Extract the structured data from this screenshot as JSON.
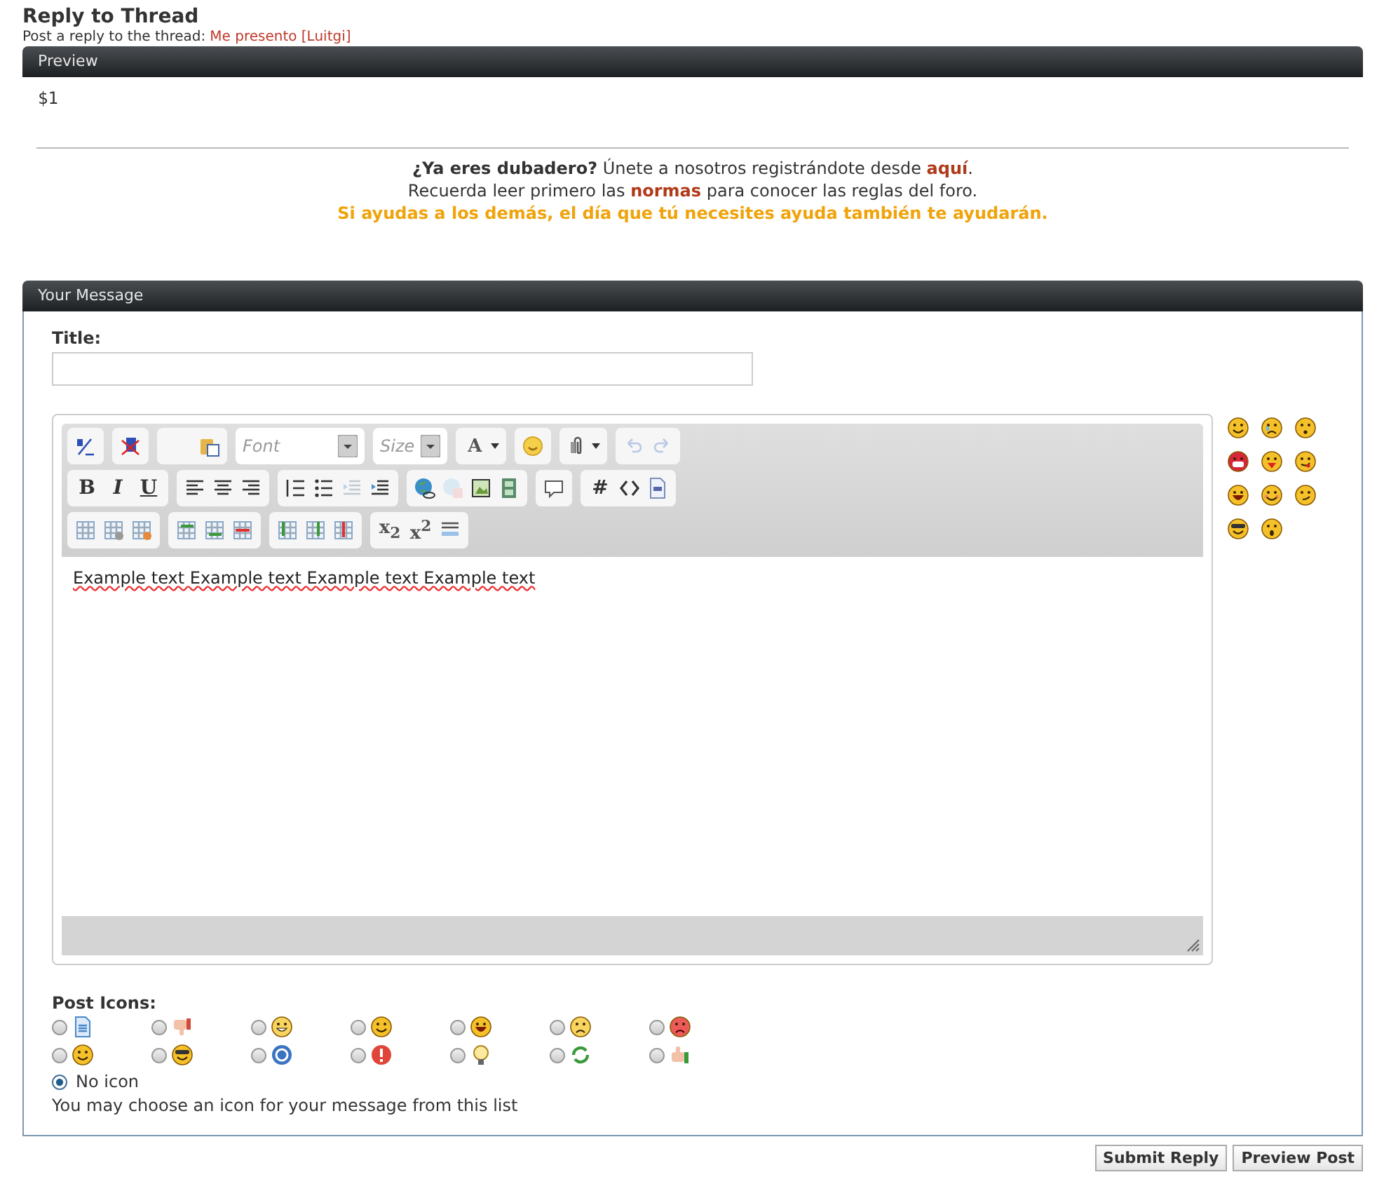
{
  "header": {
    "title": "Reply to Thread",
    "subtitle": "Post a reply to the thread:",
    "thread_link": "Me presento [Luitgi]"
  },
  "preview": {
    "title": "Preview",
    "content": "$1"
  },
  "notice": {
    "line1": {
      "before": "**¿Ya eres dubadero?** Únete a nosotros registrándote desde ",
      "link": "aquí",
      "after": "."
    },
    "line2": {
      "before": "Recuerda leer primero las ",
      "link": "normas",
      "after": " para conocer las reglas del foro."
    },
    "line3": "Si ayudas a los demás, el día que tú necesites ayuda también te ayudarán."
  },
  "message": {
    "title": "Your Message",
    "title_label": "Title:",
    "toolbar": [
      [
        [
          {
            "kind": "format"
          }
        ],
        [
          {
            "kind": "unformat"
          }
        ],
        [
          {
            "kind": "paste"
          }
        ],
        [
          {
            "kind": "select",
            "placeholder": "Font"
          }
        ],
        [
          {
            "kind": "select",
            "placeholder": "Size"
          }
        ],
        [
          {
            "kind": "color",
            "label": "A"
          }
        ],
        [
          {
            "kind": "smiley"
          }
        ],
        [
          {
            "kind": "clip"
          }
        ],
        [
          {
            "kind": "undo",
            "disabled": true
          },
          {
            "kind": "redo",
            "disabled": true
          }
        ]
      ],
      [
        [
          {
            "kind": "bold",
            "label": "B"
          },
          {
            "kind": "italic",
            "label": "I"
          },
          {
            "kind": "underline",
            "label": "U"
          }
        ],
        [
          {
            "kind": "align-left"
          },
          {
            "kind": "align-center"
          },
          {
            "kind": "align-right"
          }
        ],
        [
          {
            "kind": "ol",
            "disabled": false
          },
          {
            "kind": "ul",
            "disabled": false
          },
          {
            "kind": "outdent",
            "disabled": true
          },
          {
            "kind": "indent",
            "disabled": false
          }
        ],
        [
          {
            "kind": "globe",
            "disabled": false
          },
          {
            "kind": "unlink",
            "disabled": true
          },
          {
            "kind": "image",
            "disabled": false
          },
          {
            "kind": "film",
            "disabled": false
          }
        ],
        [
          {
            "kind": "bubble"
          }
        ],
        [
          {
            "kind": "hash",
            "label": "#"
          },
          {
            "kind": "code"
          },
          {
            "kind": "php"
          }
        ]
      ],
      [
        [
          {
            "kind": "table"
          },
          {
            "kind": "table-gear"
          },
          {
            "kind": "table-del"
          }
        ],
        [
          {
            "kind": "col-left"
          },
          {
            "kind": "col-left2"
          },
          {
            "kind": "col-right"
          }
        ],
        [
          {
            "kind": "row-down"
          },
          {
            "kind": "row-down2"
          },
          {
            "kind": "row-del"
          }
        ],
        [
          {
            "kind": "script",
            "label": "x$_{2}$"
          },
          {
            "kind": "script",
            "label": "x$^{2}$"
          },
          {
            "kind": "hr"
          }
        ]
      ]
    ],
    "editor_text": "Example text Example text Example text Example text",
    "smilies": [
      {
        "kind": "smile"
      },
      {
        "kind": "sad"
      },
      {
        "kind": "puzzled"
      },
      {
        "kind": "shout"
      },
      {
        "kind": "tongue"
      },
      {
        "kind": "cheeky"
      },
      {
        "kind": "laugh"
      },
      {
        "kind": "blush"
      },
      {
        "kind": "smirk"
      },
      {
        "kind": "cool"
      },
      {
        "kind": "surprised"
      }
    ],
    "post_icons_label": "Post Icons:",
    "post_icons": [
      {
        "kind": "doc",
        "selected": false
      },
      {
        "kind": "thumb-down",
        "selected": false
      },
      {
        "kind": "grin",
        "selected": false
      },
      {
        "kind": "smile",
        "selected": false
      },
      {
        "kind": "laugh",
        "selected": false
      },
      {
        "kind": "frown",
        "selected": false
      },
      {
        "kind": "angry",
        "selected": false
      },
      {
        "kind": "happy",
        "selected": false
      },
      {
        "kind": "cool",
        "selected": false
      },
      {
        "kind": "question",
        "selected": false
      },
      {
        "kind": "exclamation",
        "selected": false
      },
      {
        "kind": "bulb",
        "selected": false
      },
      {
        "kind": "recycle",
        "selected": false
      },
      {
        "kind": "thumb-up",
        "selected": false
      }
    ],
    "no_icon": {
      "label": "No icon",
      "selected": true
    },
    "hint": "You may choose an icon for your message from this list"
  },
  "buttons": [
    {
      "label": "Submit Reply"
    },
    {
      "label": "Preview Post"
    }
  ]
}
